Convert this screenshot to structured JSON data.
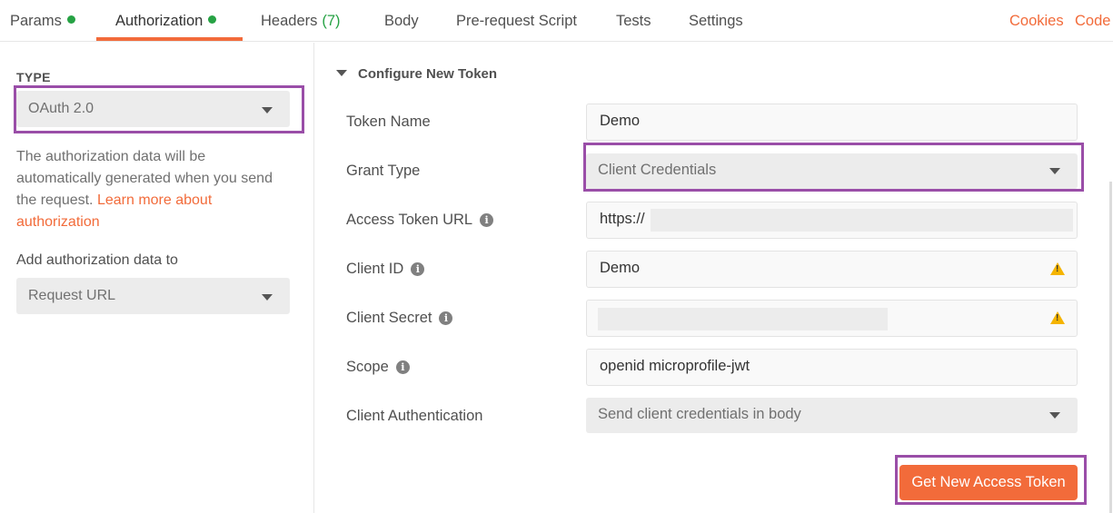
{
  "tabs": [
    {
      "label": "Params",
      "dot": true
    },
    {
      "label": "Authorization",
      "dot": true,
      "active": true
    },
    {
      "label": "Headers",
      "count": "(7)"
    },
    {
      "label": "Body"
    },
    {
      "label": "Pre-request Script"
    },
    {
      "label": "Tests"
    },
    {
      "label": "Settings"
    }
  ],
  "links": {
    "cookies": "Cookies",
    "code": "Code"
  },
  "left": {
    "type_label": "TYPE",
    "type_value": "OAuth 2.0",
    "description": "The authorization data will be automatically generated when you send the request.",
    "learn_more": "Learn more about authorization",
    "add_label": "Add authorization data to",
    "add_value": "Request URL"
  },
  "config": {
    "heading": "Configure New Token",
    "fields": {
      "token_name": {
        "label": "Token Name",
        "value": "Demo"
      },
      "grant_type": {
        "label": "Grant Type",
        "value": "Client Credentials"
      },
      "access_token_url": {
        "label": "Access Token URL",
        "value": "https://"
      },
      "client_id": {
        "label": "Client ID",
        "value": "Demo"
      },
      "client_secret": {
        "label": "Client Secret",
        "value": ""
      },
      "scope": {
        "label": "Scope",
        "value": "openid microprofile-jwt"
      },
      "client_auth": {
        "label": "Client Authentication",
        "value": "Send client credentials in body"
      }
    },
    "button": "Get New Access Token"
  },
  "colors": {
    "accent": "#f26b3a",
    "highlight": "#9a4ea8",
    "dot": "#26a244",
    "warning": "#f5b400"
  },
  "icons": {
    "info": "info-icon",
    "warning": "warning-icon",
    "dropdown": "chevron-down-icon"
  }
}
